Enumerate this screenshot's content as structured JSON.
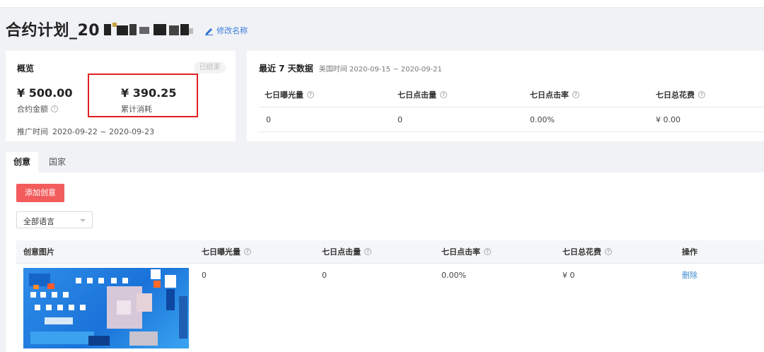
{
  "page": {
    "title": "合约计划_20",
    "edit_label": "修改名称"
  },
  "overview": {
    "heading": "概览",
    "status": "已结束",
    "contract_amount": "¥ 500.00",
    "contract_label": "合约金额",
    "spent_amount": "¥ 390.25",
    "spent_label": "累计消耗",
    "time_label": "推广时间",
    "time_value": "2020-09-22 ~ 2020-09-23"
  },
  "weekly": {
    "heading": "最近 7 天数据",
    "range": "美国时间 2020-09-15 ~ 2020-09-21",
    "columns": [
      "七日曝光量",
      "七日点击量",
      "七日点击率",
      "七日总花费"
    ],
    "values": [
      "0",
      "0",
      "0.00%",
      "¥ 0.00"
    ]
  },
  "tabs": [
    "创意",
    "国家"
  ],
  "creative": {
    "add_button": "添加创意",
    "language_select": "全部语言",
    "columns": [
      "创意图片",
      "七日曝光量",
      "七日点击量",
      "七日点击率",
      "七日总花费",
      "操作"
    ],
    "row": {
      "impressions": "0",
      "clicks": "0",
      "ctr": "0.00%",
      "spend": "¥ 0",
      "action": "删除"
    }
  },
  "icons": {
    "edit": "pencil-icon",
    "help": "question-circle-icon",
    "select": "chevron-down-icon"
  },
  "colors": {
    "primary_button": "#f25c5c",
    "link": "#3b8bd0",
    "highlight_box": "#e02020"
  }
}
